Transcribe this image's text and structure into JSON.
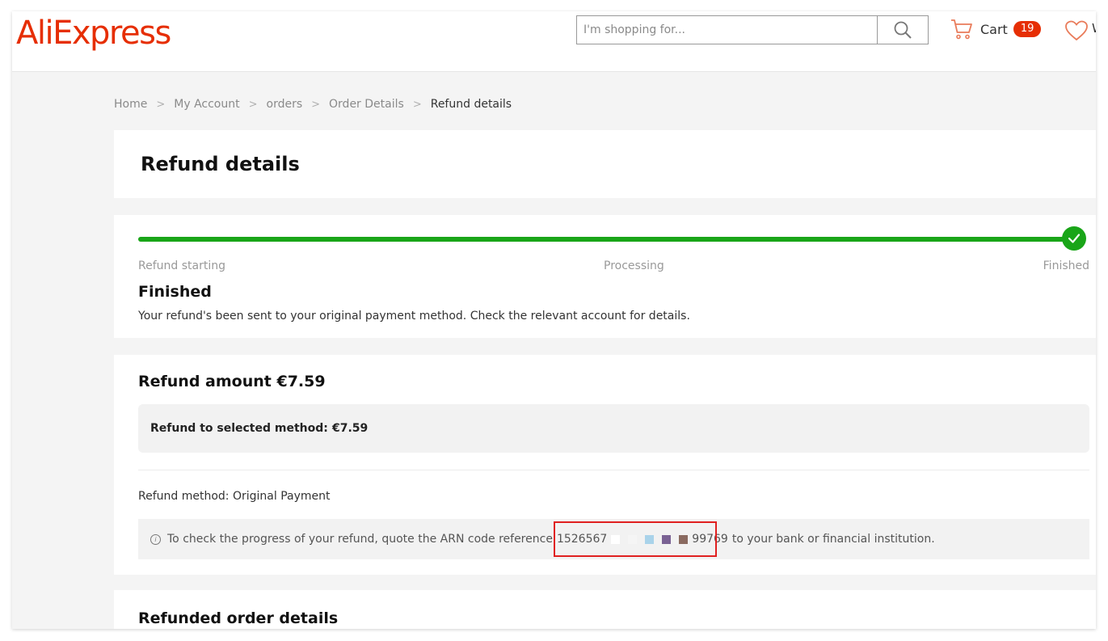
{
  "header": {
    "logo_text": "AliExpress",
    "search_placeholder": "I'm shopping for...",
    "cart_label": "Cart",
    "cart_count": "19",
    "wishlist_letter": "W"
  },
  "breadcrumb": {
    "items": [
      "Home",
      "My Account",
      "orders",
      "Order Details"
    ],
    "separator": ">",
    "current": "Refund details"
  },
  "page_title": "Refund details",
  "progress": {
    "steps": [
      "Refund starting",
      "Processing",
      "Finished"
    ],
    "completed_fraction": 1.0,
    "status_title": "Finished",
    "status_description": "Your refund's been sent to your original payment method. Check the relevant account for details."
  },
  "refund": {
    "title": "Refund amount €7.59",
    "selected_method_label": "Refund to selected method:",
    "selected_method_value": "€7.59",
    "method_text": "Refund method: Original Payment",
    "arn_prefix": "To check the progress of your refund, quote the ARN code reference",
    "arn_start": "1526567",
    "arn_end": "99769",
    "arn_suffix": "to your bank or financial institution."
  },
  "refunded_order": {
    "title": "Refunded order details"
  },
  "colors": {
    "brand": "#e62e04",
    "progress_green": "#19a518",
    "highlight_red": "#e02020"
  }
}
